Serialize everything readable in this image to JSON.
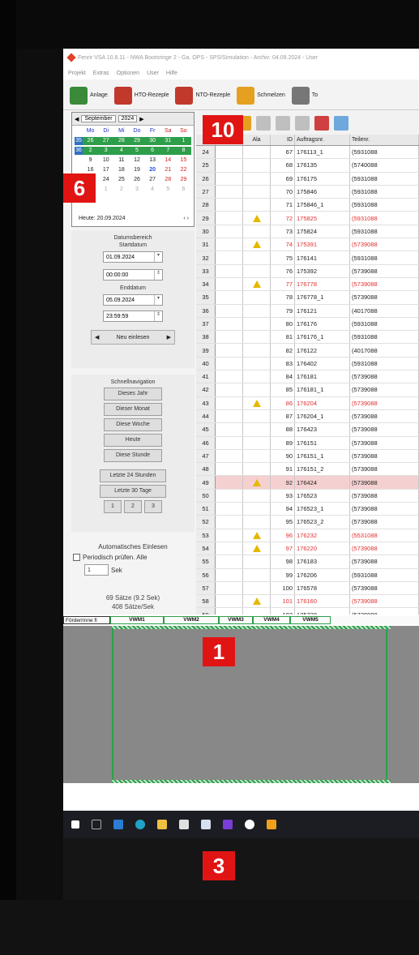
{
  "window": {
    "title": "Fenrir VSA 10.8.11 - NWA Bootsringe 2 - Ga. OPS - SPS/Simulation - Archiv: 04.09.2024 - User",
    "menu": [
      "Projekt",
      "Extras",
      "Optionen",
      "User",
      "Hilfe"
    ]
  },
  "toolbar": {
    "buttons": [
      {
        "label": "Anlage",
        "icon": "plant-icon",
        "color": "#3a8a3a"
      },
      {
        "label": "HTO-Rezeple",
        "icon": "recipe-icon",
        "color": "#c0392b"
      },
      {
        "label": "NTO-Rezeple",
        "icon": "recipe2-icon",
        "color": "#c0392b"
      },
      {
        "label": "Schmelzen",
        "icon": "melt-icon",
        "color": "#e6a020"
      },
      {
        "label": "To",
        "icon": "tools-icon",
        "color": "#777777"
      }
    ]
  },
  "calendar": {
    "month": "September",
    "year": "2024",
    "weekday_headers": [
      "Mo",
      "Di",
      "Mi",
      "Do",
      "Fr",
      "Sa",
      "So"
    ],
    "weeks": [
      {
        "wk": "35",
        "days": [
          "26",
          "27",
          "28",
          "29",
          "30",
          "31",
          "1"
        ]
      },
      {
        "wk": "36",
        "days": [
          "2",
          "3",
          "4",
          "5",
          "6",
          "7",
          "8"
        ]
      },
      {
        "wk": "",
        "days": [
          "9",
          "10",
          "11",
          "12",
          "13",
          "14",
          "15"
        ]
      },
      {
        "wk": "",
        "days": [
          "16",
          "17",
          "18",
          "19",
          "20",
          "21",
          "22"
        ]
      },
      {
        "wk": "",
        "days": [
          "23",
          "24",
          "25",
          "26",
          "27",
          "28",
          "29"
        ]
      },
      {
        "wk": "",
        "days": [
          "30",
          "1",
          "2",
          "3",
          "4",
          "5",
          "6"
        ]
      }
    ],
    "today_label": "Heute: 20.09.2024"
  },
  "date_range": {
    "title": "Datumsbereich",
    "start_label": "Startdatum",
    "start_date": "01.09.2024",
    "start_time": "00:00:00",
    "end_label": "Enddatum",
    "end_date": "05.09.2024",
    "end_time": "23:59:59",
    "reload_label": "Neu einlesen"
  },
  "quick_nav": {
    "title": "Schnellnavigation",
    "buttons": [
      "Dieses Jahr",
      "Dieser Monat",
      "Diese Woche",
      "Heute",
      "Diese Stunde"
    ],
    "range_buttons": [
      "Letzte 24 Stunden",
      "Letzte 30 Tage"
    ],
    "small_buttons": [
      "1",
      "2",
      "3"
    ]
  },
  "auto_read": {
    "title": "Automatisches Einlesen",
    "periodic_label": "Periodisch prüfen. Alle",
    "interval_value": "1",
    "interval_unit": "Sek"
  },
  "stats": {
    "line1": "69 Sätze (9.2 Sek)",
    "line2": "408 Sätze/Sek"
  },
  "table": {
    "columns": [
      "",
      "Abg",
      "Ala",
      "ID",
      "Auftragsnr.",
      "Teilenr."
    ],
    "rows": [
      {
        "rn": "24",
        "alarm": false,
        "warn": false,
        "id": "67",
        "auftrag": "176113_1",
        "teil": "(5931088"
      },
      {
        "rn": "25",
        "alarm": false,
        "warn": false,
        "id": "68",
        "auftrag": "176135",
        "teil": "(5740088"
      },
      {
        "rn": "26",
        "alarm": false,
        "warn": false,
        "id": "69",
        "auftrag": "176175",
        "teil": "(5931088"
      },
      {
        "rn": "27",
        "alarm": false,
        "warn": false,
        "id": "70",
        "auftrag": "175846",
        "teil": "(5931088"
      },
      {
        "rn": "28",
        "alarm": false,
        "warn": false,
        "id": "71",
        "auftrag": "175846_1",
        "teil": "(5931088"
      },
      {
        "rn": "29",
        "alarm": true,
        "warn": true,
        "id": "72",
        "auftrag": "175825",
        "teil": "(5931088"
      },
      {
        "rn": "30",
        "alarm": false,
        "warn": false,
        "id": "73",
        "auftrag": "175824",
        "teil": "(5931088"
      },
      {
        "rn": "31",
        "alarm": true,
        "warn": true,
        "id": "74",
        "auftrag": "175391",
        "teil": "(5739088"
      },
      {
        "rn": "32",
        "alarm": false,
        "warn": false,
        "id": "75",
        "auftrag": "176141",
        "teil": "(5931088"
      },
      {
        "rn": "33",
        "alarm": false,
        "warn": false,
        "id": "76",
        "auftrag": "175392",
        "teil": "(5739088"
      },
      {
        "rn": "34",
        "alarm": true,
        "warn": true,
        "id": "77",
        "auftrag": "176778",
        "teil": "(5739088"
      },
      {
        "rn": "35",
        "alarm": false,
        "warn": false,
        "id": "78",
        "auftrag": "176778_1",
        "teil": "(5739088"
      },
      {
        "rn": "36",
        "alarm": false,
        "warn": false,
        "id": "79",
        "auftrag": "176121",
        "teil": "(4017088"
      },
      {
        "rn": "37",
        "alarm": false,
        "warn": false,
        "id": "80",
        "auftrag": "176176",
        "teil": "(5931088"
      },
      {
        "rn": "38",
        "alarm": false,
        "warn": false,
        "id": "81",
        "auftrag": "176176_1",
        "teil": "(5931088"
      },
      {
        "rn": "39",
        "alarm": false,
        "warn": false,
        "id": "82",
        "auftrag": "176122",
        "teil": "(4017088"
      },
      {
        "rn": "40",
        "alarm": false,
        "warn": false,
        "id": "83",
        "auftrag": "176402",
        "teil": "(5931088"
      },
      {
        "rn": "41",
        "alarm": false,
        "warn": false,
        "id": "84",
        "auftrag": "176181",
        "teil": "(5739088"
      },
      {
        "rn": "42",
        "alarm": false,
        "warn": false,
        "id": "85",
        "auftrag": "176181_1",
        "teil": "(5739088"
      },
      {
        "rn": "43",
        "alarm": true,
        "warn": true,
        "id": "86",
        "auftrag": "176204",
        "teil": "(5739088"
      },
      {
        "rn": "44",
        "alarm": false,
        "warn": false,
        "id": "87",
        "auftrag": "176204_1",
        "teil": "(5739088"
      },
      {
        "rn": "45",
        "alarm": false,
        "warn": false,
        "id": "88",
        "auftrag": "176423",
        "teil": "(5739088"
      },
      {
        "rn": "46",
        "alarm": false,
        "warn": false,
        "id": "89",
        "auftrag": "176151",
        "teil": "(5739088"
      },
      {
        "rn": "47",
        "alarm": false,
        "warn": false,
        "id": "90",
        "auftrag": "176151_1",
        "teil": "(5739088"
      },
      {
        "rn": "48",
        "alarm": false,
        "warn": false,
        "id": "91",
        "auftrag": "176151_2",
        "teil": "(5739088"
      },
      {
        "rn": "49",
        "alarm": false,
        "warn": true,
        "sel": true,
        "id": "92",
        "auftrag": "176424",
        "teil": "(5739088"
      },
      {
        "rn": "50",
        "alarm": false,
        "warn": false,
        "id": "93",
        "auftrag": "176523",
        "teil": "(5739088"
      },
      {
        "rn": "51",
        "alarm": false,
        "warn": false,
        "id": "94",
        "auftrag": "176523_1",
        "teil": "(5739088"
      },
      {
        "rn": "52",
        "alarm": false,
        "warn": false,
        "id": "95",
        "auftrag": "176523_2",
        "teil": "(5739088"
      },
      {
        "rn": "53",
        "alarm": true,
        "warn": true,
        "id": "96",
        "auftrag": "176232",
        "teil": "(5531088"
      },
      {
        "rn": "54",
        "alarm": true,
        "warn": true,
        "id": "97",
        "auftrag": "176220",
        "teil": "(5739088"
      },
      {
        "rn": "55",
        "alarm": false,
        "warn": false,
        "id": "98",
        "auftrag": "176183",
        "teil": "(5739088"
      },
      {
        "rn": "56",
        "alarm": false,
        "warn": false,
        "id": "99",
        "auftrag": "176206",
        "teil": "(5931088"
      },
      {
        "rn": "57",
        "alarm": false,
        "warn": false,
        "id": "100",
        "auftrag": "176578",
        "teil": "(5739088"
      },
      {
        "rn": "58",
        "alarm": true,
        "warn": true,
        "id": "101",
        "auftrag": "176160",
        "teil": "(5739088"
      },
      {
        "rn": "59",
        "alarm": false,
        "warn": false,
        "id": "102",
        "auftrag": "175728",
        "teil": "(5739088"
      }
    ]
  },
  "conveyor": {
    "label": "Förderrinne fl",
    "segments": [
      "VWM1",
      "VWM2",
      "VWM3",
      "VWM4",
      "VWM5"
    ]
  },
  "callouts": {
    "one": "1",
    "three": "3",
    "six": "6",
    "ten": "10"
  },
  "colors": {
    "alarm_text": "#e03030",
    "callout": "#e11414",
    "calendar_green": "#2e9e4a",
    "warning": "#e5b800"
  }
}
